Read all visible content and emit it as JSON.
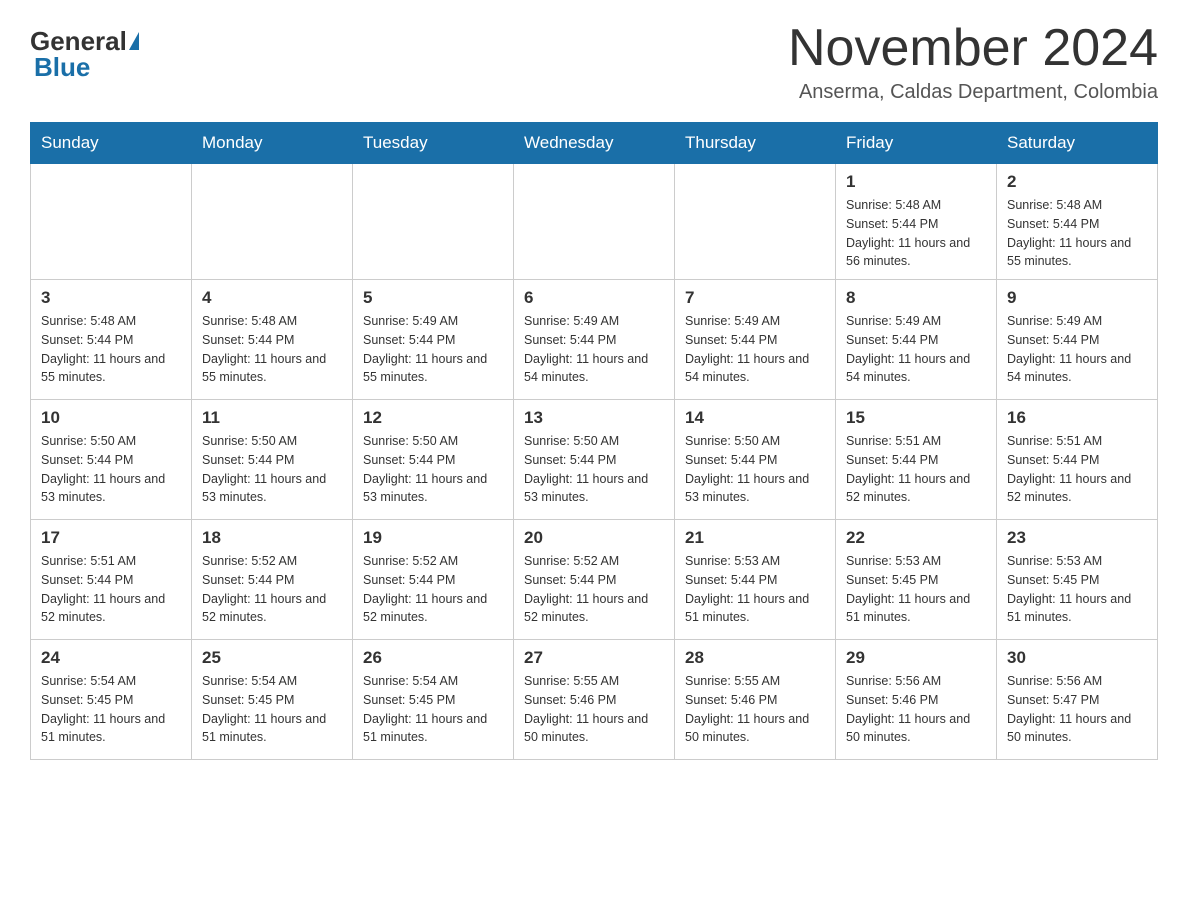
{
  "header": {
    "logo_general": "General",
    "logo_blue": "Blue",
    "month_title": "November 2024",
    "location": "Anserma, Caldas Department, Colombia"
  },
  "days_of_week": [
    "Sunday",
    "Monday",
    "Tuesday",
    "Wednesday",
    "Thursday",
    "Friday",
    "Saturday"
  ],
  "weeks": [
    [
      {
        "day": "",
        "sunrise": "",
        "sunset": "",
        "daylight": ""
      },
      {
        "day": "",
        "sunrise": "",
        "sunset": "",
        "daylight": ""
      },
      {
        "day": "",
        "sunrise": "",
        "sunset": "",
        "daylight": ""
      },
      {
        "day": "",
        "sunrise": "",
        "sunset": "",
        "daylight": ""
      },
      {
        "day": "",
        "sunrise": "",
        "sunset": "",
        "daylight": ""
      },
      {
        "day": "1",
        "sunrise": "Sunrise: 5:48 AM",
        "sunset": "Sunset: 5:44 PM",
        "daylight": "Daylight: 11 hours and 56 minutes."
      },
      {
        "day": "2",
        "sunrise": "Sunrise: 5:48 AM",
        "sunset": "Sunset: 5:44 PM",
        "daylight": "Daylight: 11 hours and 55 minutes."
      }
    ],
    [
      {
        "day": "3",
        "sunrise": "Sunrise: 5:48 AM",
        "sunset": "Sunset: 5:44 PM",
        "daylight": "Daylight: 11 hours and 55 minutes."
      },
      {
        "day": "4",
        "sunrise": "Sunrise: 5:48 AM",
        "sunset": "Sunset: 5:44 PM",
        "daylight": "Daylight: 11 hours and 55 minutes."
      },
      {
        "day": "5",
        "sunrise": "Sunrise: 5:49 AM",
        "sunset": "Sunset: 5:44 PM",
        "daylight": "Daylight: 11 hours and 55 minutes."
      },
      {
        "day": "6",
        "sunrise": "Sunrise: 5:49 AM",
        "sunset": "Sunset: 5:44 PM",
        "daylight": "Daylight: 11 hours and 54 minutes."
      },
      {
        "day": "7",
        "sunrise": "Sunrise: 5:49 AM",
        "sunset": "Sunset: 5:44 PM",
        "daylight": "Daylight: 11 hours and 54 minutes."
      },
      {
        "day": "8",
        "sunrise": "Sunrise: 5:49 AM",
        "sunset": "Sunset: 5:44 PM",
        "daylight": "Daylight: 11 hours and 54 minutes."
      },
      {
        "day": "9",
        "sunrise": "Sunrise: 5:49 AM",
        "sunset": "Sunset: 5:44 PM",
        "daylight": "Daylight: 11 hours and 54 minutes."
      }
    ],
    [
      {
        "day": "10",
        "sunrise": "Sunrise: 5:50 AM",
        "sunset": "Sunset: 5:44 PM",
        "daylight": "Daylight: 11 hours and 53 minutes."
      },
      {
        "day": "11",
        "sunrise": "Sunrise: 5:50 AM",
        "sunset": "Sunset: 5:44 PM",
        "daylight": "Daylight: 11 hours and 53 minutes."
      },
      {
        "day": "12",
        "sunrise": "Sunrise: 5:50 AM",
        "sunset": "Sunset: 5:44 PM",
        "daylight": "Daylight: 11 hours and 53 minutes."
      },
      {
        "day": "13",
        "sunrise": "Sunrise: 5:50 AM",
        "sunset": "Sunset: 5:44 PM",
        "daylight": "Daylight: 11 hours and 53 minutes."
      },
      {
        "day": "14",
        "sunrise": "Sunrise: 5:50 AM",
        "sunset": "Sunset: 5:44 PM",
        "daylight": "Daylight: 11 hours and 53 minutes."
      },
      {
        "day": "15",
        "sunrise": "Sunrise: 5:51 AM",
        "sunset": "Sunset: 5:44 PM",
        "daylight": "Daylight: 11 hours and 52 minutes."
      },
      {
        "day": "16",
        "sunrise": "Sunrise: 5:51 AM",
        "sunset": "Sunset: 5:44 PM",
        "daylight": "Daylight: 11 hours and 52 minutes."
      }
    ],
    [
      {
        "day": "17",
        "sunrise": "Sunrise: 5:51 AM",
        "sunset": "Sunset: 5:44 PM",
        "daylight": "Daylight: 11 hours and 52 minutes."
      },
      {
        "day": "18",
        "sunrise": "Sunrise: 5:52 AM",
        "sunset": "Sunset: 5:44 PM",
        "daylight": "Daylight: 11 hours and 52 minutes."
      },
      {
        "day": "19",
        "sunrise": "Sunrise: 5:52 AM",
        "sunset": "Sunset: 5:44 PM",
        "daylight": "Daylight: 11 hours and 52 minutes."
      },
      {
        "day": "20",
        "sunrise": "Sunrise: 5:52 AM",
        "sunset": "Sunset: 5:44 PM",
        "daylight": "Daylight: 11 hours and 52 minutes."
      },
      {
        "day": "21",
        "sunrise": "Sunrise: 5:53 AM",
        "sunset": "Sunset: 5:44 PM",
        "daylight": "Daylight: 11 hours and 51 minutes."
      },
      {
        "day": "22",
        "sunrise": "Sunrise: 5:53 AM",
        "sunset": "Sunset: 5:45 PM",
        "daylight": "Daylight: 11 hours and 51 minutes."
      },
      {
        "day": "23",
        "sunrise": "Sunrise: 5:53 AM",
        "sunset": "Sunset: 5:45 PM",
        "daylight": "Daylight: 11 hours and 51 minutes."
      }
    ],
    [
      {
        "day": "24",
        "sunrise": "Sunrise: 5:54 AM",
        "sunset": "Sunset: 5:45 PM",
        "daylight": "Daylight: 11 hours and 51 minutes."
      },
      {
        "day": "25",
        "sunrise": "Sunrise: 5:54 AM",
        "sunset": "Sunset: 5:45 PM",
        "daylight": "Daylight: 11 hours and 51 minutes."
      },
      {
        "day": "26",
        "sunrise": "Sunrise: 5:54 AM",
        "sunset": "Sunset: 5:45 PM",
        "daylight": "Daylight: 11 hours and 51 minutes."
      },
      {
        "day": "27",
        "sunrise": "Sunrise: 5:55 AM",
        "sunset": "Sunset: 5:46 PM",
        "daylight": "Daylight: 11 hours and 50 minutes."
      },
      {
        "day": "28",
        "sunrise": "Sunrise: 5:55 AM",
        "sunset": "Sunset: 5:46 PM",
        "daylight": "Daylight: 11 hours and 50 minutes."
      },
      {
        "day": "29",
        "sunrise": "Sunrise: 5:56 AM",
        "sunset": "Sunset: 5:46 PM",
        "daylight": "Daylight: 11 hours and 50 minutes."
      },
      {
        "day": "30",
        "sunrise": "Sunrise: 5:56 AM",
        "sunset": "Sunset: 5:47 PM",
        "daylight": "Daylight: 11 hours and 50 minutes."
      }
    ]
  ]
}
